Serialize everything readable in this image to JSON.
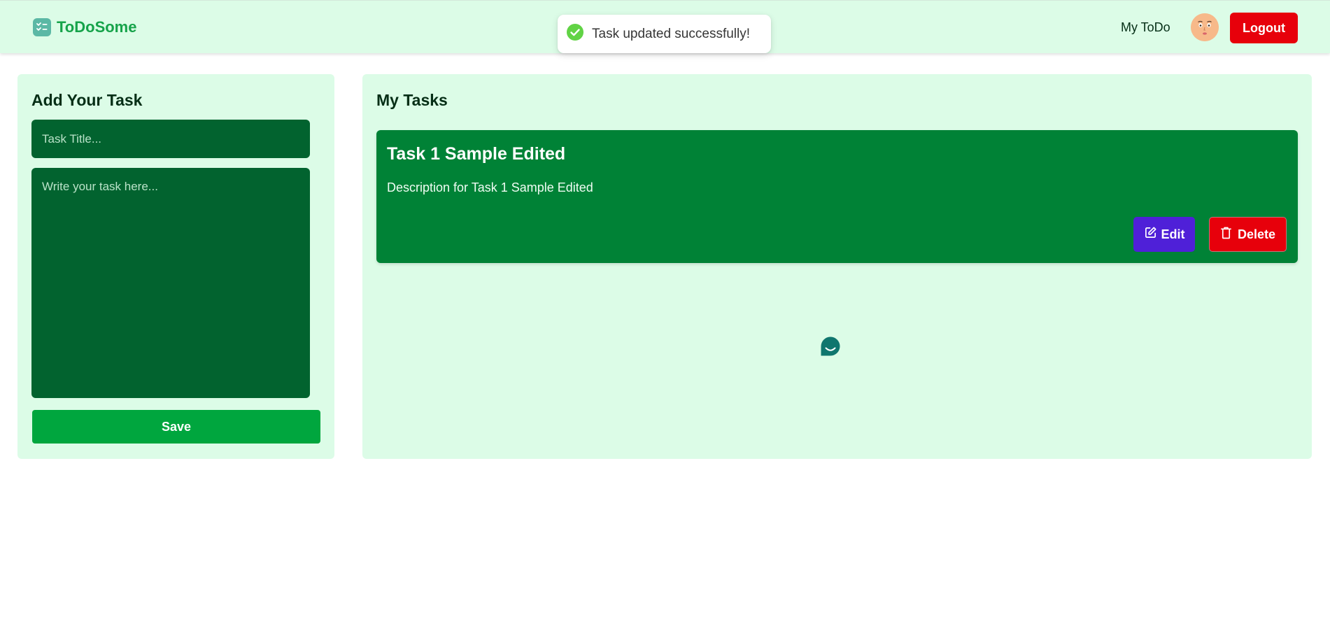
{
  "header": {
    "brand_name": "ToDoSome",
    "nav_link_label": "My ToDo",
    "logout_label": "Logout"
  },
  "toast": {
    "message": "Task updated successfully!",
    "status": "success"
  },
  "add_task": {
    "heading": "Add Your Task",
    "title_placeholder": "Task Title...",
    "title_value": "",
    "description_placeholder": "Write your task here...",
    "description_value": "",
    "save_label": "Save"
  },
  "my_tasks": {
    "heading": "My Tasks",
    "tasks": [
      {
        "title": "Task 1 Sample Edited",
        "description": "Description for Task 1 Sample Edited",
        "edit_label": "Edit",
        "delete_label": "Delete"
      }
    ]
  },
  "icons": {
    "brand": "checklist-icon",
    "toast": "check-circle-icon",
    "edit": "edit-icon",
    "delete": "trash-icon",
    "chat": "chat-bubble-icon",
    "avatar": "avatar"
  },
  "colors": {
    "header_bg": "#dcfce7",
    "brand_text": "#16a34a",
    "input_bg": "#02632f",
    "save_button": "#00a63e",
    "task_card": "#008236",
    "edit_button": "#4f20d8",
    "danger": "#e7000b",
    "success_icon": "#61d345"
  }
}
